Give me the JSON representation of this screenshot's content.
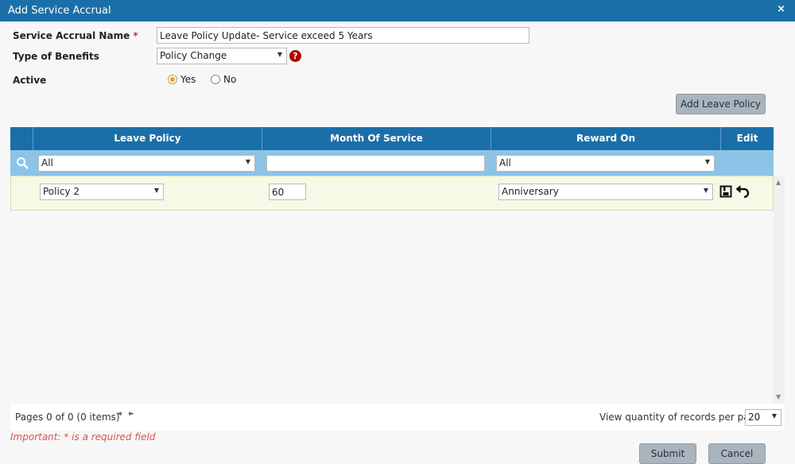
{
  "dialog": {
    "title": "Add Service Accrual",
    "close_glyph": "×"
  },
  "form": {
    "name_label": "Service Accrual Name",
    "required_mark": "*",
    "name_value": "Leave Policy Update- Service exceed 5 Years",
    "benefits_label": "Type of Benefits",
    "benefits_value": "Policy Change",
    "help_glyph": "?",
    "active_label": "Active",
    "active_yes": "Yes",
    "active_no": "No",
    "active_selected": "Yes"
  },
  "toolbar": {
    "add_leave_policy": "Add Leave Policy"
  },
  "grid": {
    "columns": [
      "Leave Policy",
      "Month Of Service",
      "Reward On",
      "Edit"
    ],
    "filters": {
      "leave_policy": "All",
      "month_of_service": "",
      "reward_on": "All"
    },
    "edit_row": {
      "leave_policy": "Policy 2",
      "month_of_service": "60",
      "reward_on": "Anniversary"
    }
  },
  "pager": {
    "info": "Pages 0 of 0 (0 items)",
    "prev_glyph": "◄",
    "next_glyph": "►",
    "per_page_label": "View quantity of records per page",
    "per_page_value": "20"
  },
  "footer": {
    "important_note": "Important: * is a required field",
    "submit": "Submit",
    "cancel": "Cancel"
  },
  "colors": {
    "header_blue": "#1b6fa8",
    "filter_blue": "#8cc3e6",
    "edit_row_bg": "#f5fae6",
    "button_gray": "#aab4bd",
    "help_red": "#b00000",
    "note_red": "#d9534f"
  },
  "icons": {
    "close": "close-icon",
    "help": "help-icon",
    "search": "search-icon",
    "save": "save-icon",
    "undo": "undo-icon",
    "dropdown": "chevron-down-icon"
  }
}
